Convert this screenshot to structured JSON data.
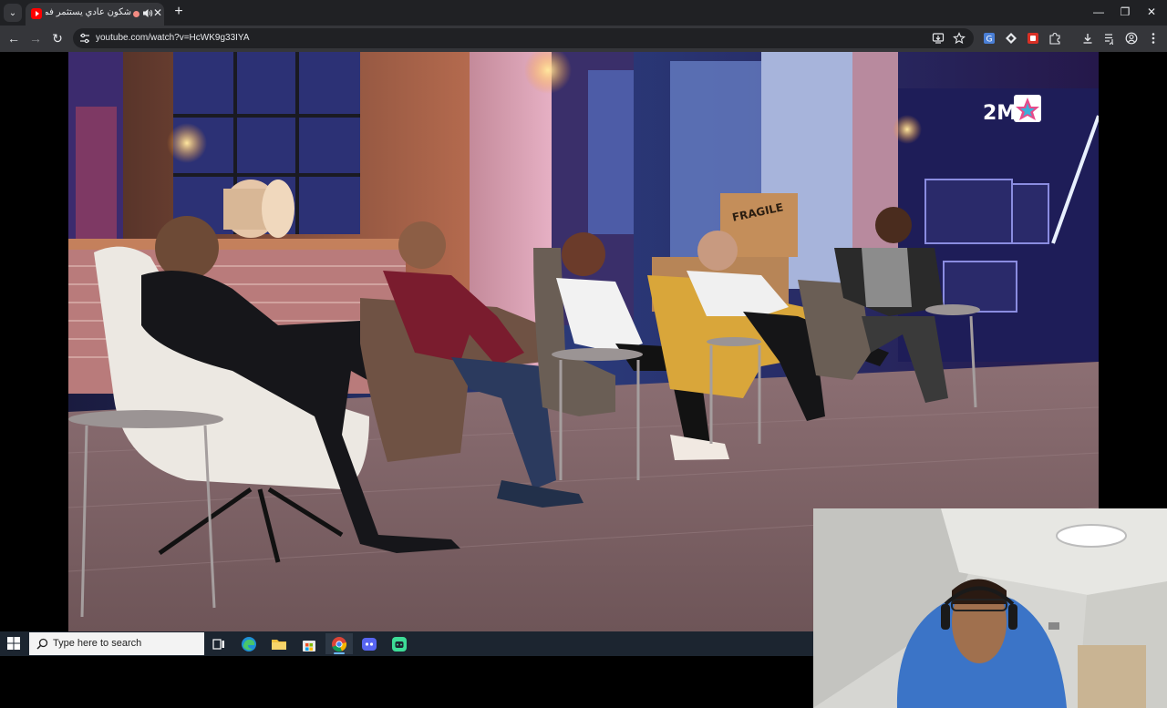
{
  "browser": {
    "tab": {
      "title": "شكون عادي يستثمر فمد...",
      "close_label": "✕"
    },
    "new_tab_label": "+",
    "window_controls": {
      "minimize": "—",
      "restore": "❐",
      "close": "✕"
    },
    "address_bar": {
      "url": "youtube.com/watch?v=HcWK9g33IYA"
    }
  },
  "video": {
    "channel_logo": "2M",
    "props": {
      "crate_label": "FRAGILE"
    }
  },
  "taskbar": {
    "search_placeholder": "Type here to search",
    "apps": [
      "task-view",
      "edge",
      "file-explorer",
      "store",
      "chrome",
      "discord",
      "app"
    ]
  },
  "colors": {
    "tab_strip": "#202124",
    "toolbar": "#35363a",
    "taskbar": "#1c2530",
    "accent": "#6cb8ff"
  }
}
